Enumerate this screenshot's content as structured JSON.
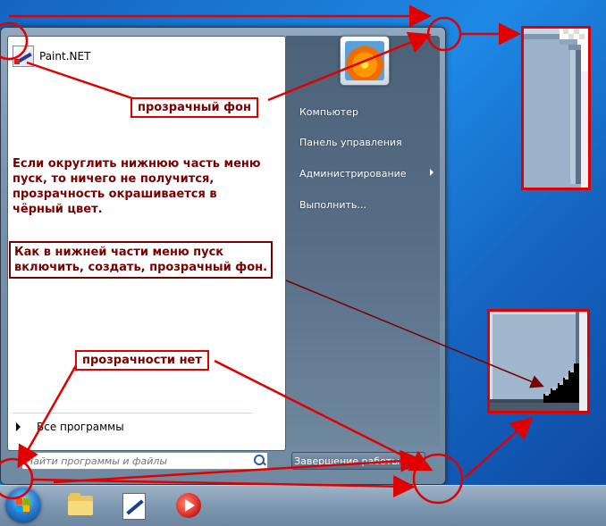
{
  "start_menu": {
    "pinned": [
      {
        "label": "Paint.NET"
      }
    ],
    "all_programs": "Все программы",
    "search_placeholder": "Найти программы и файлы",
    "right_items": [
      "Компьютер",
      "Панель управления",
      "Администрирование",
      "Выполнить..."
    ],
    "shutdown_label": "Завершение работы"
  },
  "taskbar": {
    "icons": [
      "windows-orb",
      "explorer-folder",
      "paint-net",
      "media-player"
    ]
  },
  "annotations": {
    "transparent_bg": "прозрачный фон",
    "note_rounding_line1": "Если округлить нижнюю часть меню",
    "note_rounding_line2": "пуск, то ничего не получится,",
    "note_rounding_line3": "прозрачность окрашивается в",
    "note_rounding_line4": "чёрный цвет.",
    "question_line1": "Как в нижней части меню пуск",
    "question_line2": "включить, создать, прозрачный фон.",
    "no_transparency": "прозрачности нет"
  },
  "colors": {
    "annotation_red": "#e00000",
    "annotation_dark_red": "#7a0000",
    "desktop_blue": "#1e88e5"
  }
}
